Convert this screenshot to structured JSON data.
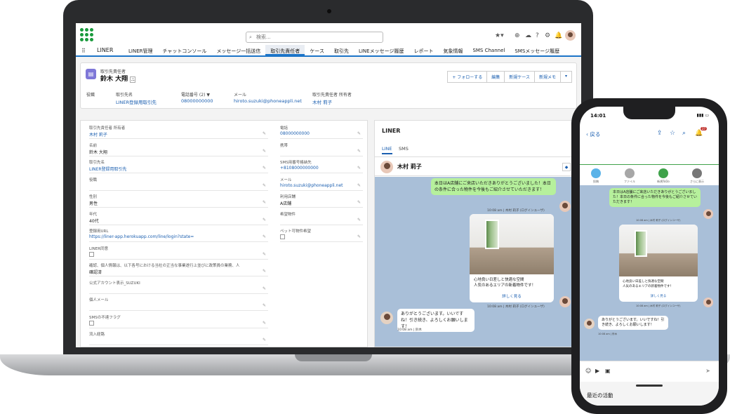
{
  "laptop": {
    "search_placeholder": "検索...",
    "app_name": "LINER",
    "nav_items": [
      "LINER管理",
      "チャットコンソール",
      "メッセージ一括送信",
      "取引先責任者",
      "ケース",
      "取引先",
      "LINEメッセージ履歴",
      "レポート",
      "気象情報",
      "SMS Channel",
      "SMSメッセージ履歴"
    ],
    "nav_active": "取引先責任者",
    "record": {
      "object_label": "取引先責任者",
      "title": "鈴木 大翔",
      "buttons": [
        "+ フォローする",
        "編集",
        "新規ケース",
        "新規メモ"
      ],
      "highlights": [
        {
          "label": "役職",
          "value": ""
        },
        {
          "label": "取引先名",
          "value": "LINER登録用取引先"
        },
        {
          "label": "電話番号 (2) ▼",
          "value": "08000000000"
        },
        {
          "label": "メール",
          "value": "hiroto.suzuki@phoneappli.net"
        },
        {
          "label": "取引先責任者 所有者",
          "value": "木村 莉子"
        }
      ]
    },
    "details_left": [
      {
        "label": "取引先責任者 所有者",
        "value": "木村 莉子",
        "link": true
      },
      {
        "label": "名前",
        "value": "鈴木 大翔",
        "link": false
      },
      {
        "label": "取引先名",
        "value": "LINER登録用取引先",
        "link": true
      },
      {
        "label": "役職",
        "value": "",
        "link": false
      },
      {
        "label": "性別",
        "value": "男性",
        "link": false
      },
      {
        "label": "年代",
        "value": "40代",
        "link": false
      },
      {
        "label": "登録用URL",
        "value": "https://liner-app.herokuapp.com/line/login?state=",
        "link": true
      },
      {
        "label": "LINER同意",
        "value": "",
        "link": false
      },
      {
        "label": "確認、個人情報は、以下各号における当社の正当な事業遂行上並びに政策員の業務、人",
        "value": "確認済",
        "link": false
      },
      {
        "label": "公式アカウント表示_SUZUKI",
        "value": "",
        "link": false
      },
      {
        "label": "個人メール",
        "value": "",
        "link": false
      },
      {
        "label": "SMSの不達フラグ",
        "value": "",
        "link": false
      },
      {
        "label": "流入経路",
        "value": "",
        "link": false
      }
    ],
    "details_right": [
      {
        "label": "電話",
        "value": "08000000000",
        "link": true
      },
      {
        "label": "携帯",
        "value": "",
        "link": false
      },
      {
        "label": "SMS用番号格納先",
        "value": "+8108000000000",
        "link": true
      },
      {
        "label": "メール",
        "value": "hiroto.suzuki@phoneappli.net",
        "link": true
      },
      {
        "label": "利用店舗",
        "value": "A店舗",
        "link": false
      },
      {
        "label": "希望物件",
        "value": "",
        "link": false
      },
      {
        "label": "ペット可物件希望",
        "value": "",
        "link": false
      }
    ],
    "chat": {
      "panel_title": "LINER",
      "tabs": [
        "LINE",
        "SMS"
      ],
      "contact_name": "木村 莉子",
      "msg1": "本日はA店舗にご来店いただきありがとうございました！本日の条件に合った物件を今後もご紹介させていただきます！",
      "msg1_time": "10:08 am | 木村 莉子 (ログインユーザ)",
      "card_text": "心地良い日差しと快適な空間\n人気のあるエリアの新着物件です！",
      "card_more": "詳しく見る",
      "card_time": "10:08 am | 木村 莉子 (ログインユーザ)",
      "msg2": "ありがとうございます。いいですね！引き続き、よろしくお願いします！",
      "msg2_time": "10:08 am | 鈴木"
    }
  },
  "phone": {
    "time": "14:01",
    "back_label": "戻る",
    "badge": "27",
    "actions": [
      "投稿",
      "ファイル",
      "新規ToDo",
      "さらに表示"
    ],
    "msg1": "本日はA店舗にご来店いただきありがとうございました！本日の条件に合った物件を今後もご紹介させていただきます！",
    "msg1_time": "10:08 am | 木村 莉子 (ログインユーザ)",
    "card_text": "心地良い日差しと快適な空間\n人気のあるエリアの新着物件です！",
    "card_more": "詳しく見る",
    "card_time": "10:08 am | 木村 莉子 (ログインユーザ)",
    "msg2": "ありがとうございます。いいですね！引き続き、よろしくお願いします！",
    "msg2_time": "10:08 am | 鈴木",
    "footer_label": "最近の活動"
  }
}
